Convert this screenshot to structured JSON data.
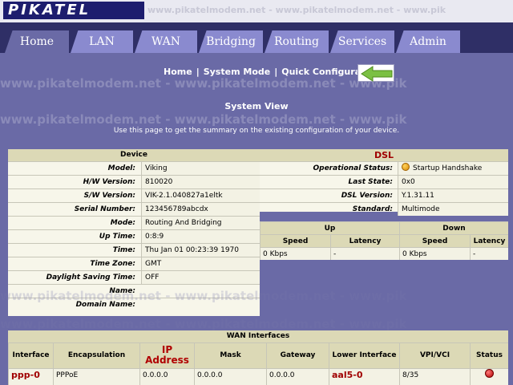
{
  "brand": {
    "logo": "PIKATEL",
    "watermark": "www.pikatelmodem.net - www.pikatelmodem.net - www.pik"
  },
  "tabs": [
    {
      "label": "Home"
    },
    {
      "label": "LAN"
    },
    {
      "label": "WAN"
    },
    {
      "label": "Bridging"
    },
    {
      "label": "Routing"
    },
    {
      "label": "Services"
    },
    {
      "label": "Admin"
    }
  ],
  "nav": {
    "home": "Home",
    "system_mode": "System Mode",
    "quick_config": "Quick Configuration",
    "sep": "|"
  },
  "page": {
    "title": "System View",
    "description": "Use this page to get the summary on the existing configuration of your device."
  },
  "device": {
    "header": "Device",
    "rows": [
      {
        "label": "Model:",
        "value": "Viking"
      },
      {
        "label": "H/W Version:",
        "value": "810020"
      },
      {
        "label": "S/W Version:",
        "value": "VIK-2.1.040827a1eltk"
      },
      {
        "label": "Serial Number:",
        "value": "123456789abcdx"
      },
      {
        "label": "Mode:",
        "value": "Routing And Bridging"
      },
      {
        "label": "Up Time:",
        "value": "0:8:9"
      },
      {
        "label": "Time:",
        "value": "Thu Jan 01 00:23:39 1970"
      },
      {
        "label": "Time Zone:",
        "value": "GMT"
      },
      {
        "label": "Daylight Saving Time:",
        "value": "OFF"
      },
      {
        "label": "Name:",
        "value": ""
      },
      {
        "label": "Domain Name:",
        "value": ""
      }
    ]
  },
  "dsl": {
    "header": "DSL",
    "rows": [
      {
        "label": "Operational Status:",
        "value": "Startup Handshake"
      },
      {
        "label": "Last State:",
        "value": "0x0"
      },
      {
        "label": "DSL Version:",
        "value": "Y.1.31.11"
      },
      {
        "label": "Standard:",
        "value": "Multimode"
      }
    ],
    "up": "Up",
    "down": "Down",
    "speed": "Speed",
    "latency": "Latency",
    "up_speed": "0 Kbps",
    "up_latency": "-",
    "down_speed": "0 Kbps",
    "down_latency": "-"
  },
  "wan": {
    "header": "WAN Interfaces",
    "columns": [
      "Interface",
      "Encapsulation",
      "IP Address",
      "Mask",
      "Gateway",
      "Lower Interface",
      "VPI/VCI",
      "Status"
    ],
    "rows": [
      {
        "interface": "ppp-0",
        "encapsulation": "PPPoE",
        "ip": "0.0.0.0",
        "mask": "0.0.0.0",
        "gateway": "0.0.0.0",
        "lower": "aal5-0",
        "vpivci": "8/35"
      }
    ]
  },
  "colors": {
    "bg": "#6a6aa6",
    "tabbar": "#2f2f66",
    "panel": "#f7f6ea",
    "header": "#dcd9b6",
    "accent_red": "#a00000"
  }
}
